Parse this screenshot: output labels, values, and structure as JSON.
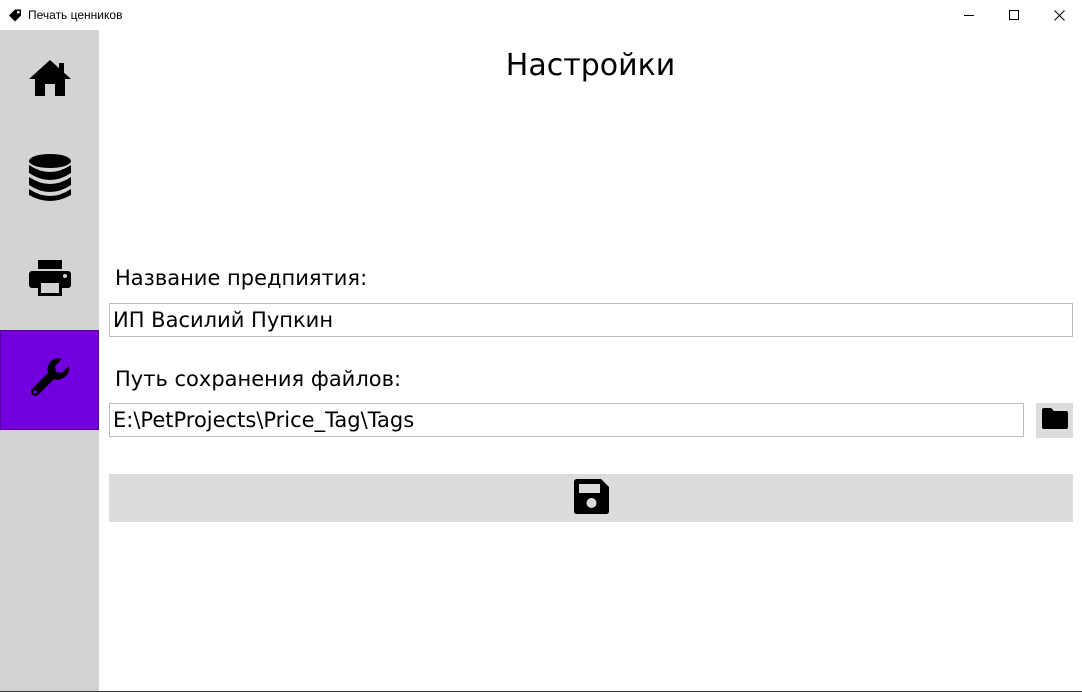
{
  "window": {
    "title": "Печать ценников",
    "app_icon": "tag-icon",
    "controls": [
      "minimize-icon",
      "maximize-icon",
      "close-icon"
    ]
  },
  "sidebar": {
    "background": "#d3d3d3",
    "active_color": "#7200de",
    "items": [
      {
        "icon": "home-icon",
        "active": false
      },
      {
        "icon": "database-icon",
        "active": false
      },
      {
        "icon": "printer-icon",
        "active": false
      },
      {
        "icon": "wrench-icon",
        "active": true
      }
    ]
  },
  "page": {
    "title": "Настройки"
  },
  "form": {
    "company_label": "Название предпиятия:",
    "company_value": "ИП Василий Пупкин",
    "path_label": "Путь сохранения файлов:",
    "path_value": "E:\\PetProjects\\Price_Tag\\Tags",
    "browse_icon": "folder-icon",
    "save_icon": "floppy-disk-icon"
  }
}
